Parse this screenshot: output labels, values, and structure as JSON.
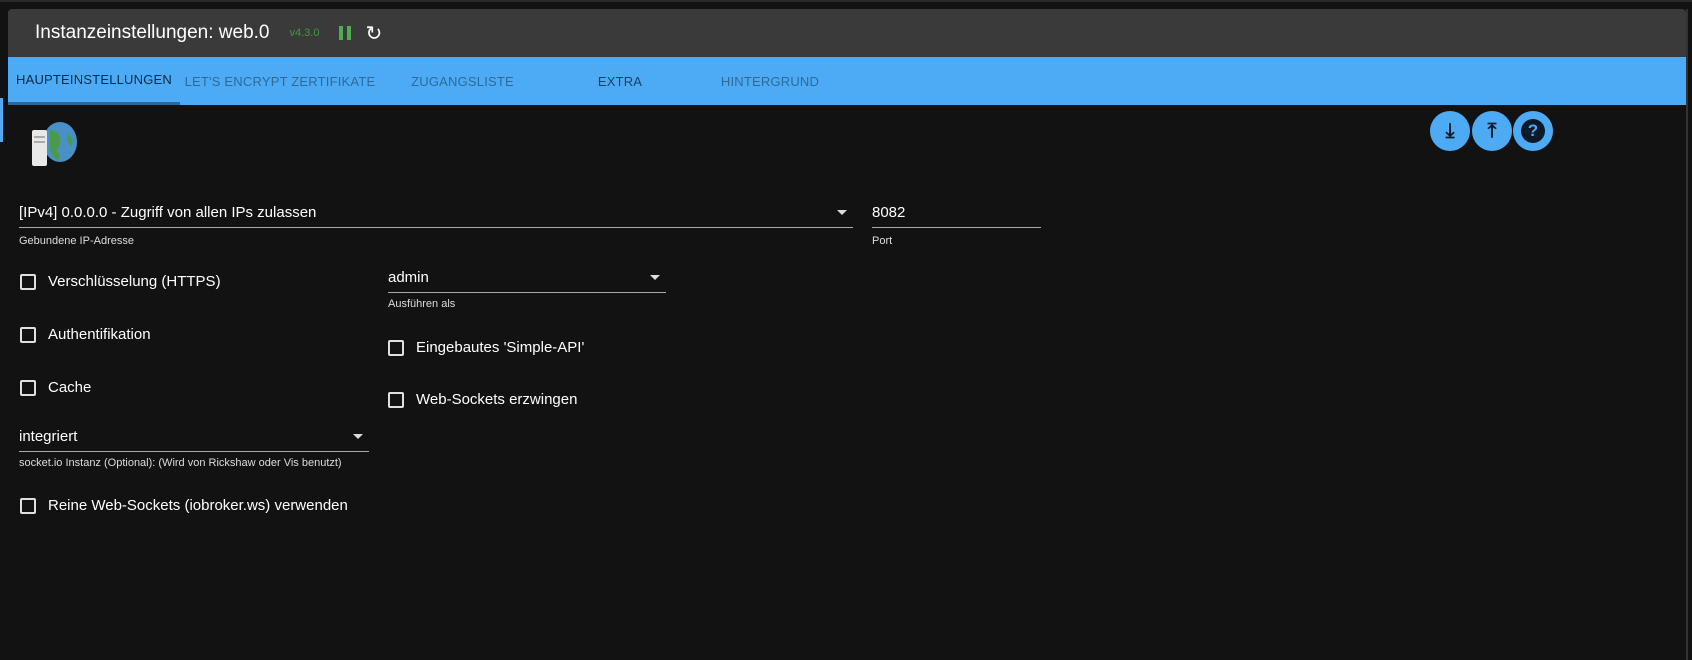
{
  "header": {
    "title": "Instanzeinstellungen: web.0",
    "version": "v4.3.0"
  },
  "tabs": [
    "HAUPTEINSTELLUNGEN",
    "LET'S ENCRYPT ZERTIFIKATE",
    "ZUGANGSLISTE",
    "EXTRA",
    "HINTERGRUND"
  ],
  "fields": {
    "ip": {
      "value": "[IPv4] 0.0.0.0 - Zugriff von allen IPs zulassen",
      "label": "Gebundene IP-Adresse"
    },
    "port": {
      "value": "8082",
      "label": "Port"
    },
    "run_as": {
      "value": "admin",
      "label": "Ausführen als"
    },
    "socketio": {
      "value": "integriert",
      "label": "socket.io Instanz (Optional): (Wird von Rickshaw oder Vis benutzt)"
    }
  },
  "checkboxes": {
    "https": "Verschlüsselung (HTTPS)",
    "auth": "Authentifikation",
    "cache": "Cache",
    "simple_api": "Eingebautes 'Simple-API'",
    "force_ws": "Web-Sockets erzwingen",
    "pure_ws": "Reine Web-Sockets (iobroker.ws) verwenden"
  },
  "colors": {
    "accent": "#4dabf5",
    "header": "#3a3a3a",
    "version": "#3d9b3d"
  }
}
